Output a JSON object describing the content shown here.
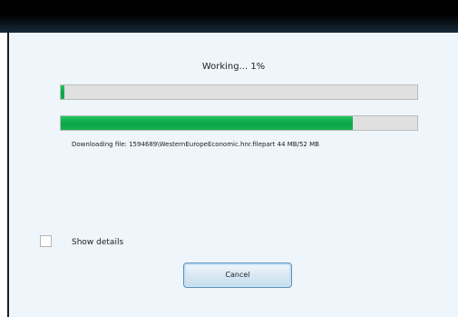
{
  "dialog": {
    "status_text": "Working... 1%",
    "overall_progress_percent": 1,
    "file_progress_percent": 82,
    "file_status": "Downloading file:  1594689\\WesternEuropeEconomic.hnr.filepart 44 MB/52 MB",
    "show_details": {
      "label": "Show details",
      "checked": false
    },
    "cancel_label": "Cancel"
  },
  "colors": {
    "progress_fill": "#0ba347",
    "progress_track": "#e0e0e0",
    "dialog_background": "#eef5fb",
    "titlebar": "#000000"
  }
}
